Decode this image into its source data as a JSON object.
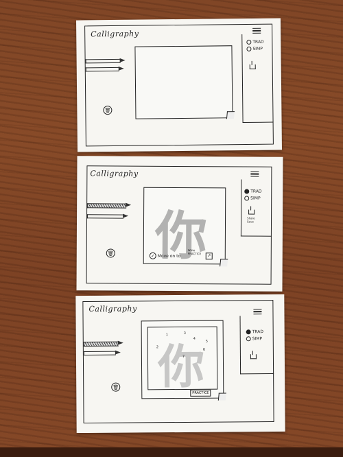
{
  "app_title": "Calligraphy",
  "mode_options": [
    "TRAD",
    "SIMP"
  ],
  "trash_icon": "trash-icon",
  "share_icon": "share-icon",
  "menu_icon": "hamburger-menu-icon",
  "sketch2": {
    "share_label": "Share\nSave",
    "character": "你",
    "move_on_label": "Move on to",
    "next_label": "Write\nPRACTICE"
  },
  "sketch3": {
    "character": "你",
    "practice_button": "PRACTICE",
    "stroke_numbers": [
      "1",
      "2",
      "3",
      "4",
      "5",
      "6",
      "7"
    ]
  }
}
